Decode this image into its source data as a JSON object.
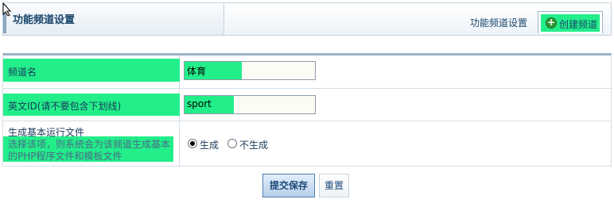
{
  "header": {
    "title": "功能频道设置",
    "tabs": [
      {
        "label": "功能频道设置"
      },
      {
        "label": "创建频道"
      }
    ],
    "icons": {
      "cursor": "cursor-icon",
      "add": "plus-circle-icon"
    }
  },
  "form": {
    "channel_name": {
      "label": "频道名",
      "value": "体育"
    },
    "english_id": {
      "label": "英文ID(请不要包含下划线)",
      "value": "sport"
    },
    "generate_file": {
      "label": "生成基本运行文件",
      "description_line1": "选择该项，则系统会为该频道生成基本",
      "description_line2": "的PHP程序文件和模板文件",
      "options": [
        {
          "label": "生成",
          "checked": true
        },
        {
          "label": "不生成",
          "checked": false
        }
      ]
    }
  },
  "buttons": {
    "submit": "提交保存",
    "reset": "重置"
  },
  "colors": {
    "highlight": "#22ee8a",
    "title": "#17456b",
    "border": "#d4dde6",
    "input_bg": "#fdfcf4"
  }
}
